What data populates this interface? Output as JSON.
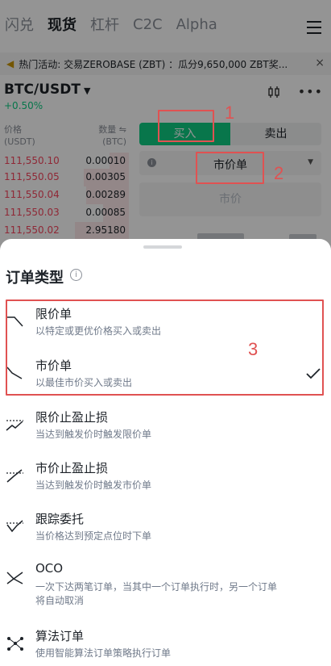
{
  "nav": {
    "tabs": [
      "闪兑",
      "现货",
      "杠杆",
      "C2C",
      "Alpha"
    ],
    "active_index": 1
  },
  "banner": {
    "text": "热门活动: 交易ZEROBASE (ZBT) ：瓜分9,650,000 ZBT奖...",
    "close": "×"
  },
  "pair": {
    "symbol": "BTC/USDT",
    "change": "+0.50%",
    "change_color": "#0ecb81"
  },
  "orderbook": {
    "price_header": "价格",
    "price_unit": "(USDT)",
    "qty_header": "数量 ⇋",
    "qty_unit": "(BTC)",
    "asks": [
      {
        "price": "111,550.10",
        "qty": "0.00010",
        "depth": 0.15
      },
      {
        "price": "111,550.05",
        "qty": "0.00305",
        "depth": 0.35
      },
      {
        "price": "111,550.04",
        "qty": "0.00289",
        "depth": 0.33
      },
      {
        "price": "111,550.03",
        "qty": "0.00085",
        "depth": 0.2
      },
      {
        "price": "111,550.02",
        "qty": "2.95180",
        "depth": 0.42
      }
    ]
  },
  "trade": {
    "buy_label": "买入",
    "sell_label": "卖出",
    "order_type_value": "市价单",
    "price_placeholder": "市价",
    "buy_color": "#0ecb81"
  },
  "annotations": [
    "1",
    "2",
    "3"
  ],
  "sheet": {
    "title": "订单类型",
    "selected_index": 1,
    "items": [
      {
        "icon": "limit-order-icon",
        "name": "限价单",
        "desc": "以特定或更优价格买入或卖出"
      },
      {
        "icon": "market-order-icon",
        "name": "市价单",
        "desc": "以最佳市价买入或卖出"
      },
      {
        "icon": "limit-tp-sl-icon",
        "name": "限价止盈止损",
        "desc": "当达到触发价时触发限价单"
      },
      {
        "icon": "market-tp-sl-icon",
        "name": "市价止盈止损",
        "desc": "当达到触发价时触发市价单"
      },
      {
        "icon": "trailing-stop-icon",
        "name": "跟踪委托",
        "desc": "当价格达到预定点位时下单"
      },
      {
        "icon": "oco-icon",
        "name": "OCO",
        "desc": "一次下达两笔订单，当其中一个订单执行时，另一个订单",
        "desc2": "将自动取消"
      },
      {
        "icon": "algo-order-icon",
        "name": "算法订单",
        "desc": "使用智能算法订单策略执行订单"
      }
    ]
  },
  "colors": {
    "annotation": "#e05252",
    "ask": "#f6465d"
  }
}
